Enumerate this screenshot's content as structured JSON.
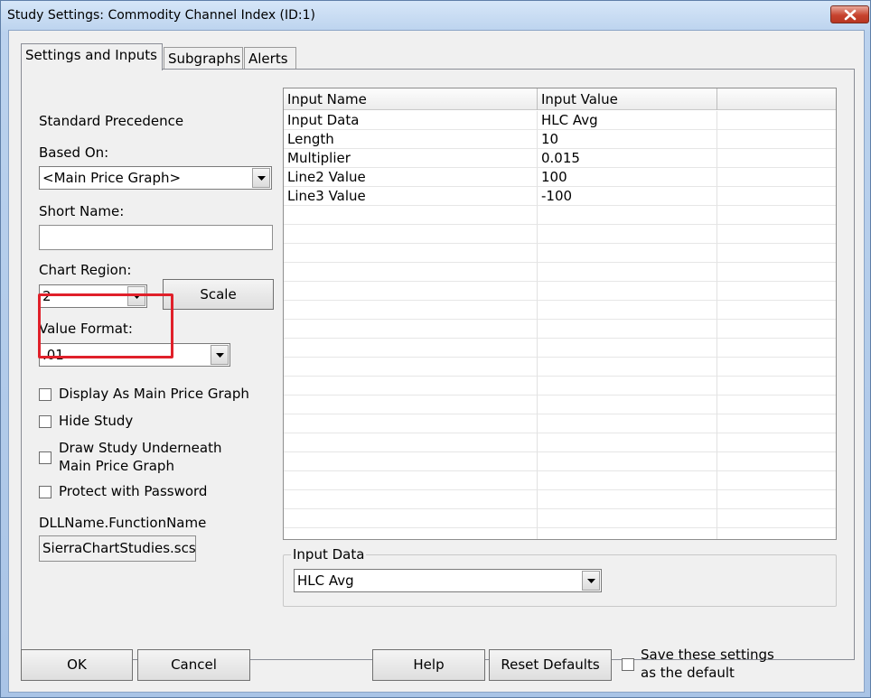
{
  "window": {
    "title": "Study Settings: Commodity Channel Index (ID:1)"
  },
  "tabs": [
    "Settings and Inputs",
    "Subgraphs",
    "Alerts"
  ],
  "left": {
    "standard_precedence": "Standard Precedence",
    "based_on_label": "Based On:",
    "based_on_value": "<Main Price Graph>",
    "short_name_label": "Short Name:",
    "short_name_value": "",
    "chart_region_label": "Chart Region:",
    "chart_region_value": "2",
    "scale_label": "Scale",
    "value_format_label": "Value Format:",
    "value_format_value": ".01",
    "checkboxes": [
      {
        "label": "Display As Main Price Graph",
        "checked": false
      },
      {
        "label": "Hide Study",
        "checked": false
      },
      {
        "label": "Draw Study Underneath",
        "label2": "Main Price Graph",
        "checked": false
      },
      {
        "label": "Protect with Password",
        "checked": false
      }
    ],
    "dll_label": "DLLName.FunctionName",
    "dll_value": "SierraChartStudies.scs"
  },
  "grid": {
    "headers": [
      "Input Name",
      "Input Value",
      ""
    ],
    "rows": [
      [
        "Input Data",
        "HLC Avg"
      ],
      [
        "Length",
        "10"
      ],
      [
        "Multiplier",
        "0.015"
      ],
      [
        "Line2 Value",
        "100"
      ],
      [
        "Line3 Value",
        "-100"
      ]
    ]
  },
  "input_group": {
    "legend": "Input Data",
    "selected": "HLC Avg"
  },
  "footer": {
    "ok": "OK",
    "cancel": "Cancel",
    "help": "Help",
    "reset": "Reset Defaults",
    "save_line1": "Save these settings",
    "save_line2": "as the default"
  },
  "colors": {
    "highlight": "#e0202a",
    "close_button": "#c7432f"
  }
}
